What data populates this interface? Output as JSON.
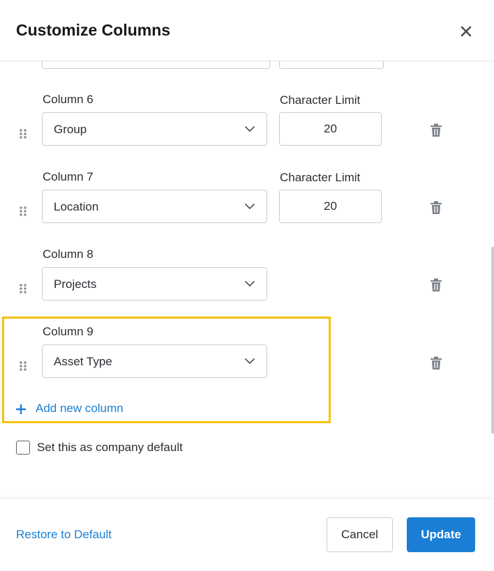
{
  "dialog": {
    "title": "Customize Columns",
    "close_icon": "close-icon"
  },
  "columns": [
    {
      "label": "Column 6",
      "value": "Group",
      "limit_label": "Character Limit",
      "limit": "20"
    },
    {
      "label": "Column 7",
      "value": "Location",
      "limit_label": "Character Limit",
      "limit": "20"
    },
    {
      "label": "Column 8",
      "value": "Projects"
    },
    {
      "label": "Column 9",
      "value": "Asset Type"
    }
  ],
  "add_column": {
    "label": "Add new column",
    "icon": "plus-icon"
  },
  "company_default": {
    "label": "Set this as company default",
    "checked": false
  },
  "footer": {
    "restore_label": "Restore to Default",
    "cancel_label": "Cancel",
    "update_label": "Update"
  },
  "colors": {
    "accent": "#1a7fd4",
    "highlight": "#f5c20c"
  }
}
